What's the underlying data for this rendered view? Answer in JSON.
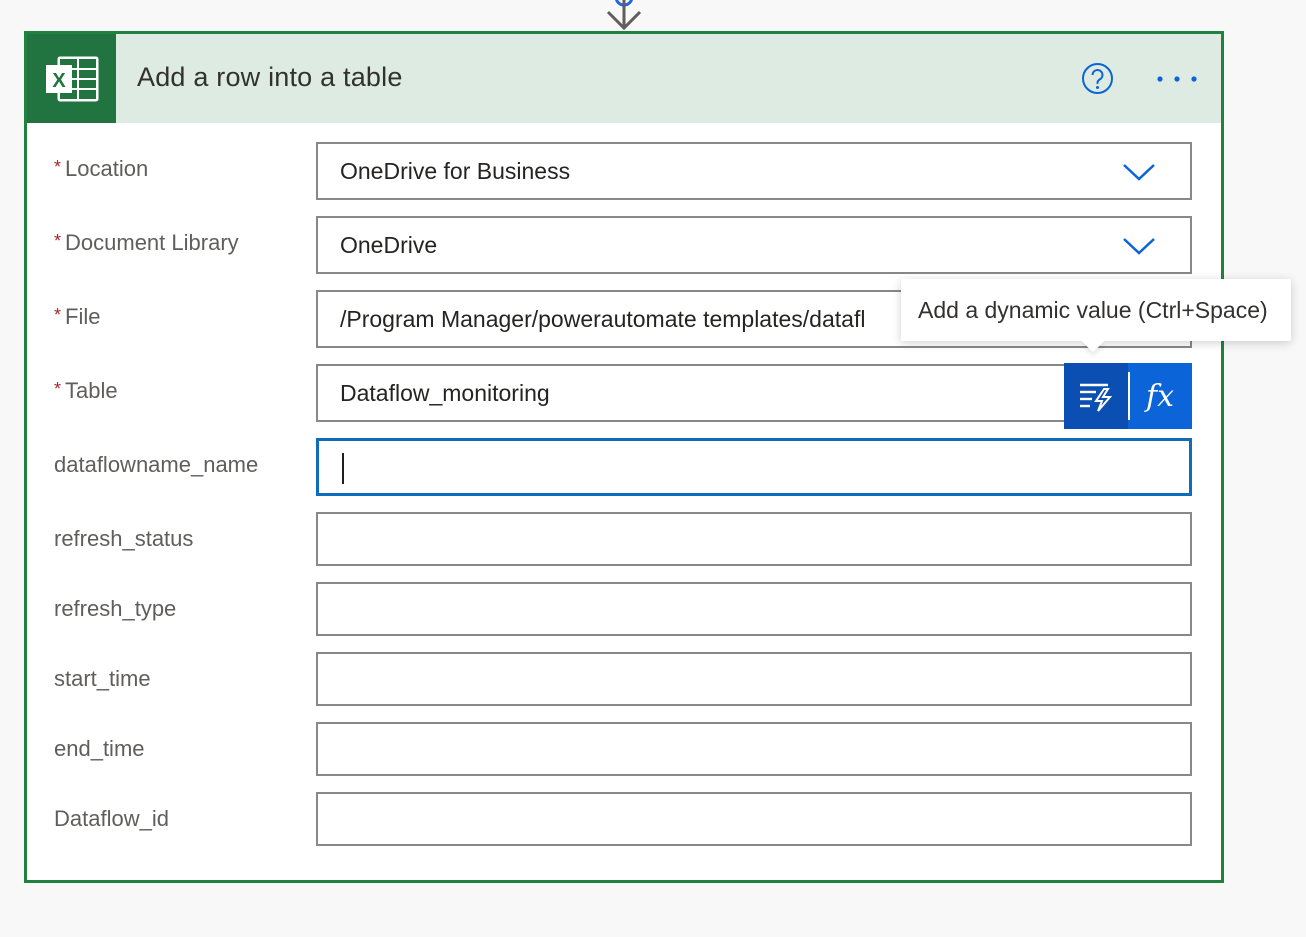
{
  "card": {
    "title": "Add a row into a table"
  },
  "required_marker": "*",
  "fields": [
    {
      "label": "Location",
      "required": true,
      "value": "OneDrive for Business",
      "type": "dropdown"
    },
    {
      "label": "Document Library",
      "required": true,
      "value": "OneDrive",
      "type": "dropdown"
    },
    {
      "label": "File",
      "required": true,
      "value": "/Program Manager/powerautomate templates/datafl",
      "type": "text"
    },
    {
      "label": "Table",
      "required": true,
      "value": "Dataflow_monitoring",
      "type": "text"
    },
    {
      "label": "dataflowname_name",
      "required": false,
      "value": "",
      "type": "text",
      "focused": true
    },
    {
      "label": "refresh_status",
      "required": false,
      "value": "",
      "type": "text"
    },
    {
      "label": "refresh_type",
      "required": false,
      "value": "",
      "type": "text"
    },
    {
      "label": "start_time",
      "required": false,
      "value": "",
      "type": "text"
    },
    {
      "label": "end_time",
      "required": false,
      "value": "",
      "type": "text"
    },
    {
      "label": "Dataflow_id",
      "required": false,
      "value": "",
      "type": "text"
    }
  ],
  "tooltip": {
    "text": "Add a dynamic value (Ctrl+Space)"
  },
  "buttons": {
    "dynamic_content_icon": "dynamic-content-icon",
    "expression_label": "fx"
  },
  "icons": {
    "app": "excel-icon",
    "help": "help-icon",
    "more": "more-options-icon",
    "dropdown": "chevron-down-icon",
    "connector": "arrow-down-icon"
  },
  "colors": {
    "accent_green": "#21813f",
    "header_bg": "#deebe3",
    "excel_green": "#21733f",
    "focus_blue": "#0f6cbd",
    "link_blue": "#0b64d8",
    "required_red": "#a4262c"
  }
}
